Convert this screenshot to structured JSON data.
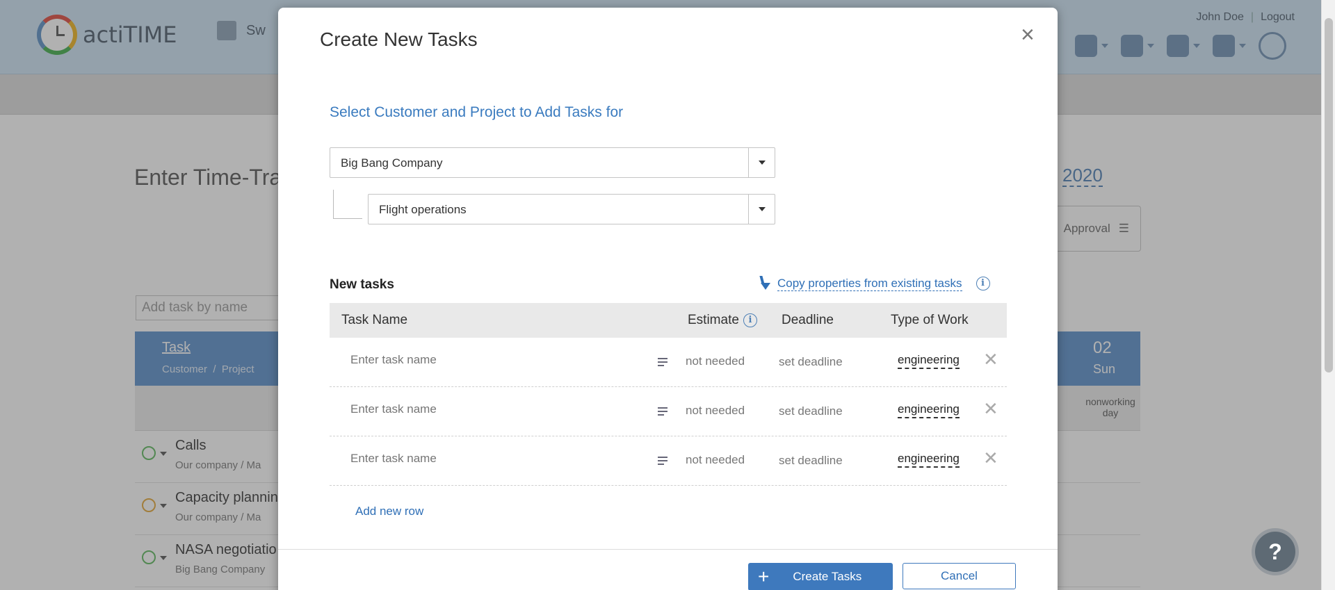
{
  "app": {
    "logo_text": "actiTIME",
    "switch_text": "Sw",
    "user_name": "John Doe",
    "logout": "Logout",
    "page_title": "Enter Time-Track for",
    "date_title": "2020",
    "approval_label": "Approval",
    "add_task_placeholder": "Add task by name",
    "grid": {
      "task_header": "Task",
      "customer_header": "Customer",
      "project_header": "Project",
      "day_number": "02",
      "day_name": "Sun",
      "nonworking": "nonworking day"
    },
    "rows": [
      {
        "name": "Calls",
        "path": "Our company  /  Ma"
      },
      {
        "name": "Capacity plannin",
        "path": "Our company  /  Ma"
      },
      {
        "name": "NASA negotiatio",
        "path": "Big Bang Company"
      }
    ],
    "help_fab": "?"
  },
  "modal": {
    "title": "Create New Tasks",
    "close": "×",
    "section_heading": "Select Customer and Project to Add Tasks for",
    "customer_value": "Big Bang Company",
    "project_value": "Flight operations",
    "new_tasks_label": "New tasks",
    "copy_link": "Copy properties from existing tasks",
    "info_glyph": "i",
    "columns": {
      "task_name": "Task Name",
      "estimate": "Estimate",
      "deadline": "Deadline",
      "type_of_work": "Type of Work"
    },
    "task_rows": [
      {
        "placeholder": "Enter task name",
        "estimate": "not needed",
        "deadline": "set deadline",
        "type_of_work": "engineering"
      },
      {
        "placeholder": "Enter task name",
        "estimate": "not needed",
        "deadline": "set deadline",
        "type_of_work": "engineering"
      },
      {
        "placeholder": "Enter task name",
        "estimate": "not needed",
        "deadline": "set deadline",
        "type_of_work": "engineering"
      }
    ],
    "remove_glyph": "✕",
    "add_row": "Add new row",
    "create_button": "Create Tasks",
    "create_plus": "+",
    "cancel_button": "Cancel"
  },
  "colors": {
    "accent": "#3e79bd",
    "link": "#2f6fb6",
    "header_bg": "#cde3f5",
    "grid_header": "#5b8fcc"
  },
  "icons": [
    "calendar-icon",
    "gear-icon",
    "puzzle-icon",
    "help-icon",
    "lightbulb-icon",
    "clock-icon",
    "info-icon",
    "close-icon",
    "plus-icon",
    "description-icon",
    "arrow-down-icon"
  ]
}
